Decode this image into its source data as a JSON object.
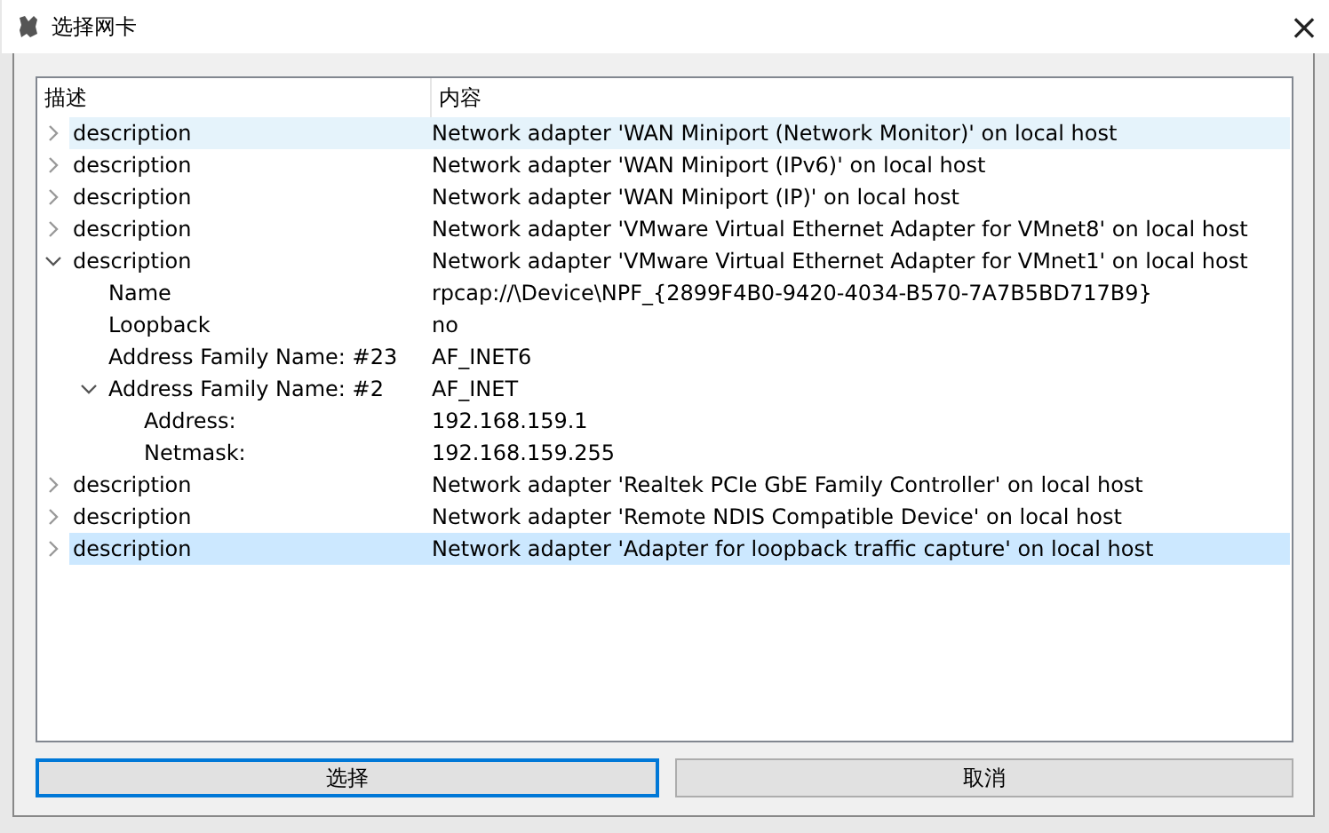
{
  "window": {
    "title": "选择网卡",
    "close": "×"
  },
  "tree": {
    "columns": [
      "描述",
      "内容"
    ],
    "rows": [
      {
        "label": "description",
        "value": "Network adapter 'WAN Miniport (Network Monitor)' on local host",
        "expanded": false,
        "hovered": true,
        "selected": false
      },
      {
        "label": "description",
        "value": "Network adapter 'WAN Miniport (IPv6)' on local host",
        "expanded": false,
        "hovered": false,
        "selected": false
      },
      {
        "label": "description",
        "value": "Network adapter 'WAN Miniport (IP)' on local host",
        "expanded": false,
        "hovered": false,
        "selected": false
      },
      {
        "label": "description",
        "value": "Network adapter 'VMware Virtual Ethernet Adapter for VMnet8' on local host",
        "expanded": false,
        "hovered": false,
        "selected": false
      },
      {
        "label": "description",
        "value": "Network adapter 'VMware Virtual Ethernet Adapter for VMnet1' on local host",
        "expanded": true,
        "hovered": false,
        "selected": false,
        "children": [
          {
            "label": "Name",
            "value": "rpcap://\\Device\\NPF_{2899F4B0-9420-4034-B570-7A7B5BD717B9}",
            "hovered": false,
            "selected": false
          },
          {
            "label": "Loopback",
            "value": "no",
            "hovered": false,
            "selected": false
          },
          {
            "label": "Address Family Name: #23",
            "value": "AF_INET6",
            "hovered": false,
            "selected": false
          },
          {
            "label": "Address Family Name: #2",
            "value": "AF_INET",
            "expanded": true,
            "hovered": false,
            "selected": false,
            "children": [
              {
                "label": "Address:",
                "value": "192.168.159.1",
                "hovered": false,
                "selected": false
              },
              {
                "label": "Netmask:",
                "value": "192.168.159.255",
                "hovered": false,
                "selected": false
              }
            ]
          }
        ]
      },
      {
        "label": "description",
        "value": "Network adapter 'Realtek PCIe GbE Family Controller' on local host",
        "expanded": false,
        "hovered": false,
        "selected": false
      },
      {
        "label": "description",
        "value": "Network adapter 'Remote NDIS Compatible Device' on local host",
        "expanded": false,
        "hovered": false,
        "selected": false
      },
      {
        "label": "description",
        "value": "Network adapter 'Adapter for loopback traffic capture' on local host",
        "expanded": false,
        "hovered": false,
        "selected": true
      }
    ]
  },
  "buttons": [
    {
      "label": "选择",
      "focused": true
    },
    {
      "label": "取消",
      "focused": false
    }
  ]
}
